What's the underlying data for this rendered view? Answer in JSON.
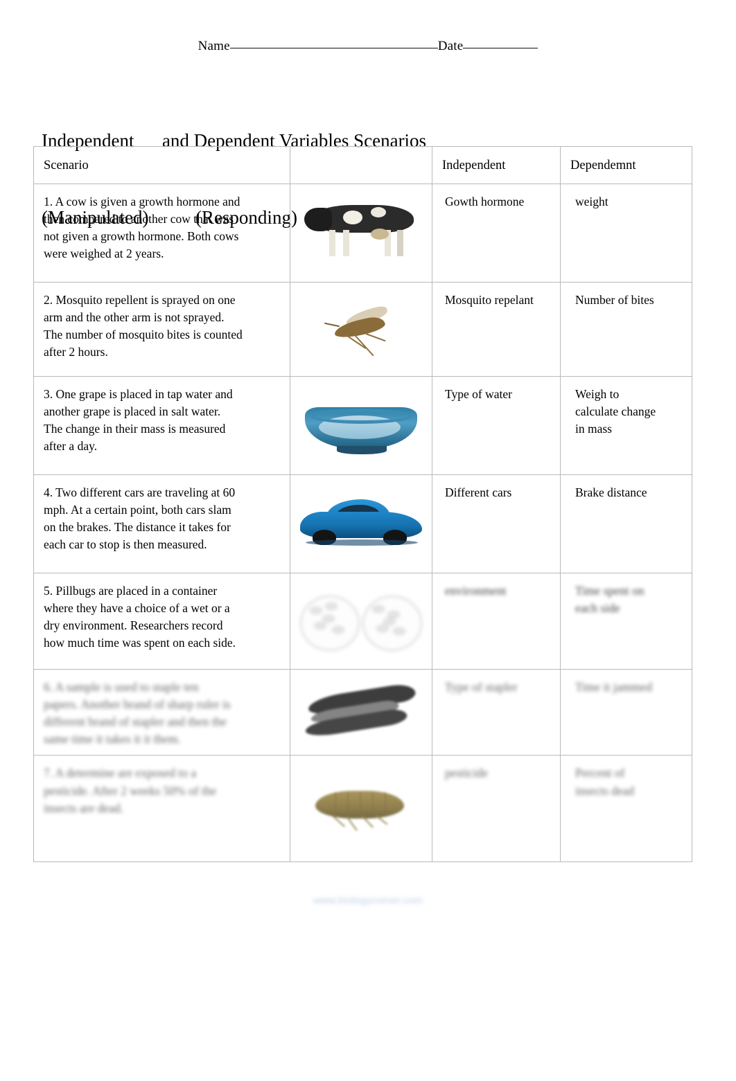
{
  "header": {
    "name_label": "Name",
    "date_label": "Date"
  },
  "title": {
    "line1": "Independent      and Dependent Variables Scenarios",
    "line2": "(Manipulated)          (Responding)"
  },
  "table": {
    "columns": [
      "Scenario",
      "",
      "Independent",
      "Dependemnt"
    ],
    "rows": [
      {
        "scenario": "1.   A cow is given a growth hormone and\nthen compared to another cow that was\nnot given a growth hormone.      Both cows\nwere weighed at 2 years.",
        "picture": "cow-photo",
        "independent": "Gowth hormone",
        "dependent": "weight",
        "clarity": "sharp"
      },
      {
        "scenario": "2.   Mosquito repellent is sprayed on one\narm and the other arm is not sprayed.\nThe number of mosquito bites is counted\nafter 2 hours.",
        "picture": "mosquito-photo",
        "independent": "Mosquito repelant",
        "dependent": "Number of bites",
        "clarity": "sharp"
      },
      {
        "scenario": "3.   One grape is placed in tap water and\nanother grape is placed in salt water.\nThe change in their mass is measured\nafter a day.",
        "picture": "blue-bowl-photo",
        "independent": "Type of water",
        "dependent": " Weigh to\ncalculate change\nin mass",
        "clarity": "sharp"
      },
      {
        "scenario": "4.   Two different cars are traveling at 60\nmph.   At a certain point, both cars slam\non the brakes.      The distance it takes for\neach car to stop is then measured.",
        "picture": "blue-car-photo",
        "independent": "Different cars",
        "dependent": "Brake distance",
        "clarity": "sharp"
      },
      {
        "scenario": "5.   Pillbugs are placed in a container\nwhere they have a choice of a wet or a\ndry environment.     Researchers record\nhow much time was spent on each side.",
        "picture": "petri-dishes-photo",
        "independent": "environment",
        "dependent": "Time spent on\neach side",
        "clarity": "slightly-blurred"
      },
      {
        "scenario": "6.   A sample is used to staple ten\npapers. Another brand of sharp ruler is\ndifferent brand of stapler and then the\nsame time it takes it it them.",
        "picture": "stapler-photo",
        "independent": "Type of stapler",
        "dependent": "Time it jammed",
        "clarity": "blurred"
      },
      {
        "scenario": "7.    A determine are exposed to a\npesticide.      After 2 weeks 50% of the\ninsects are dead.",
        "picture": "pillbug-photo",
        "independent": "pesticide",
        "dependent": "Percent of\ninsects dead",
        "clarity": "heavily-blurred"
      }
    ]
  },
  "footer": {
    "link_text": "www.biologycorner.com"
  },
  "colors": {
    "page_background": "#ffffff",
    "text": "#000000",
    "table_border": "#b9b9b9",
    "link": "#9bb4d8"
  }
}
